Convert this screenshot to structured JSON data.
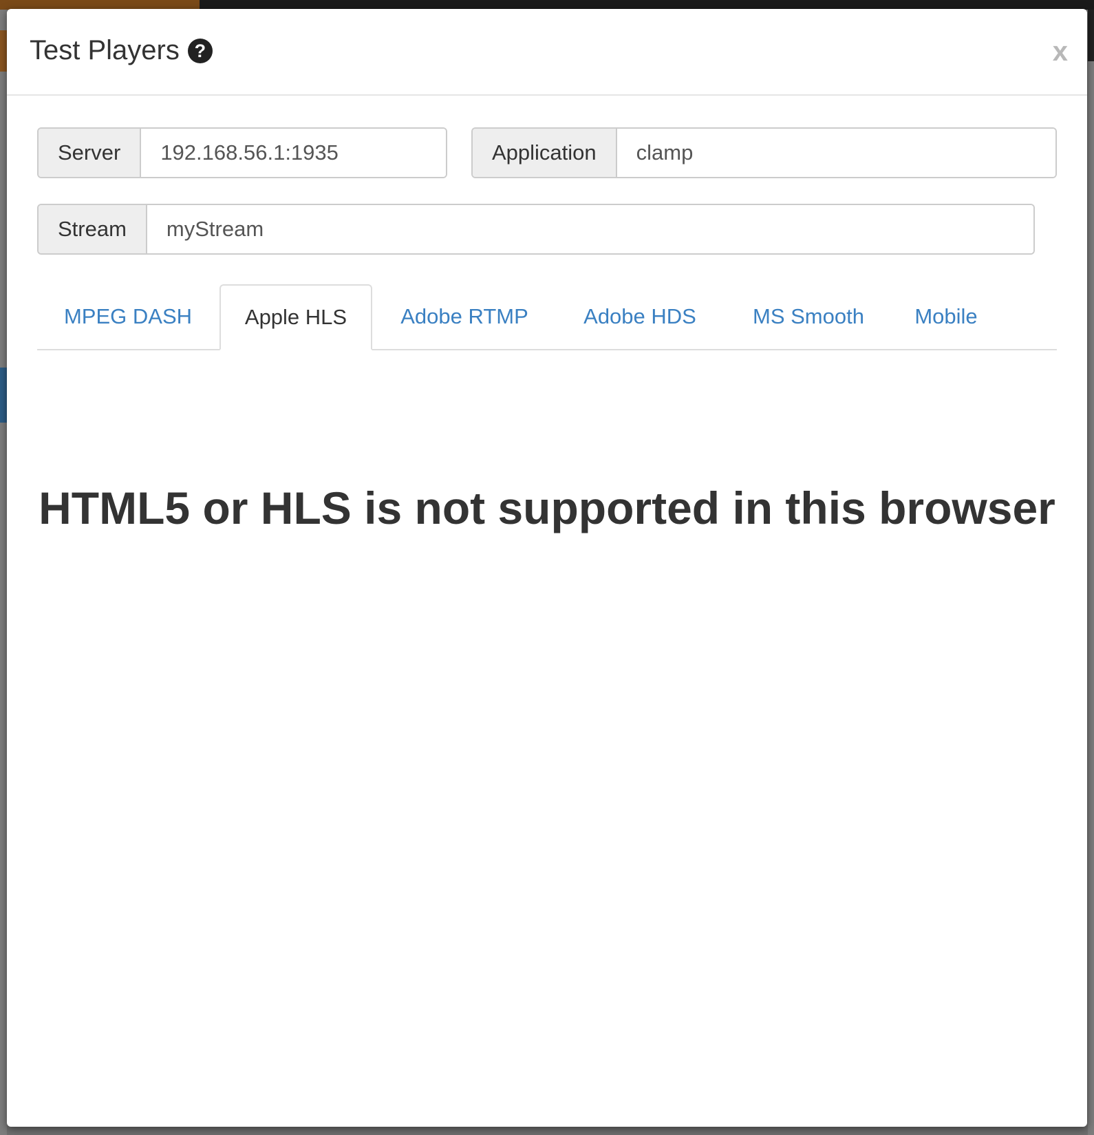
{
  "modal": {
    "title": "Test Players",
    "help_icon": "question-circle-icon",
    "close_label": "x"
  },
  "fields": {
    "server": {
      "label": "Server",
      "value": "192.168.56.1:1935"
    },
    "application": {
      "label": "Application",
      "value": "clamp"
    },
    "stream": {
      "label": "Stream",
      "value": "myStream"
    }
  },
  "tabs": [
    {
      "label": "MPEG DASH",
      "active": false
    },
    {
      "label": "Apple HLS",
      "active": true
    },
    {
      "label": "Adobe RTMP",
      "active": false
    },
    {
      "label": "Adobe HDS",
      "active": false
    },
    {
      "label": "MS Smooth",
      "active": false
    },
    {
      "label": "Mobile",
      "active": false
    }
  ],
  "player": {
    "message": "HTML5 or HLS is not supported in this browser"
  },
  "colors": {
    "link": "#3a80c2",
    "text": "#333333",
    "addon_bg": "#eeeeee",
    "border": "#cccccc"
  }
}
